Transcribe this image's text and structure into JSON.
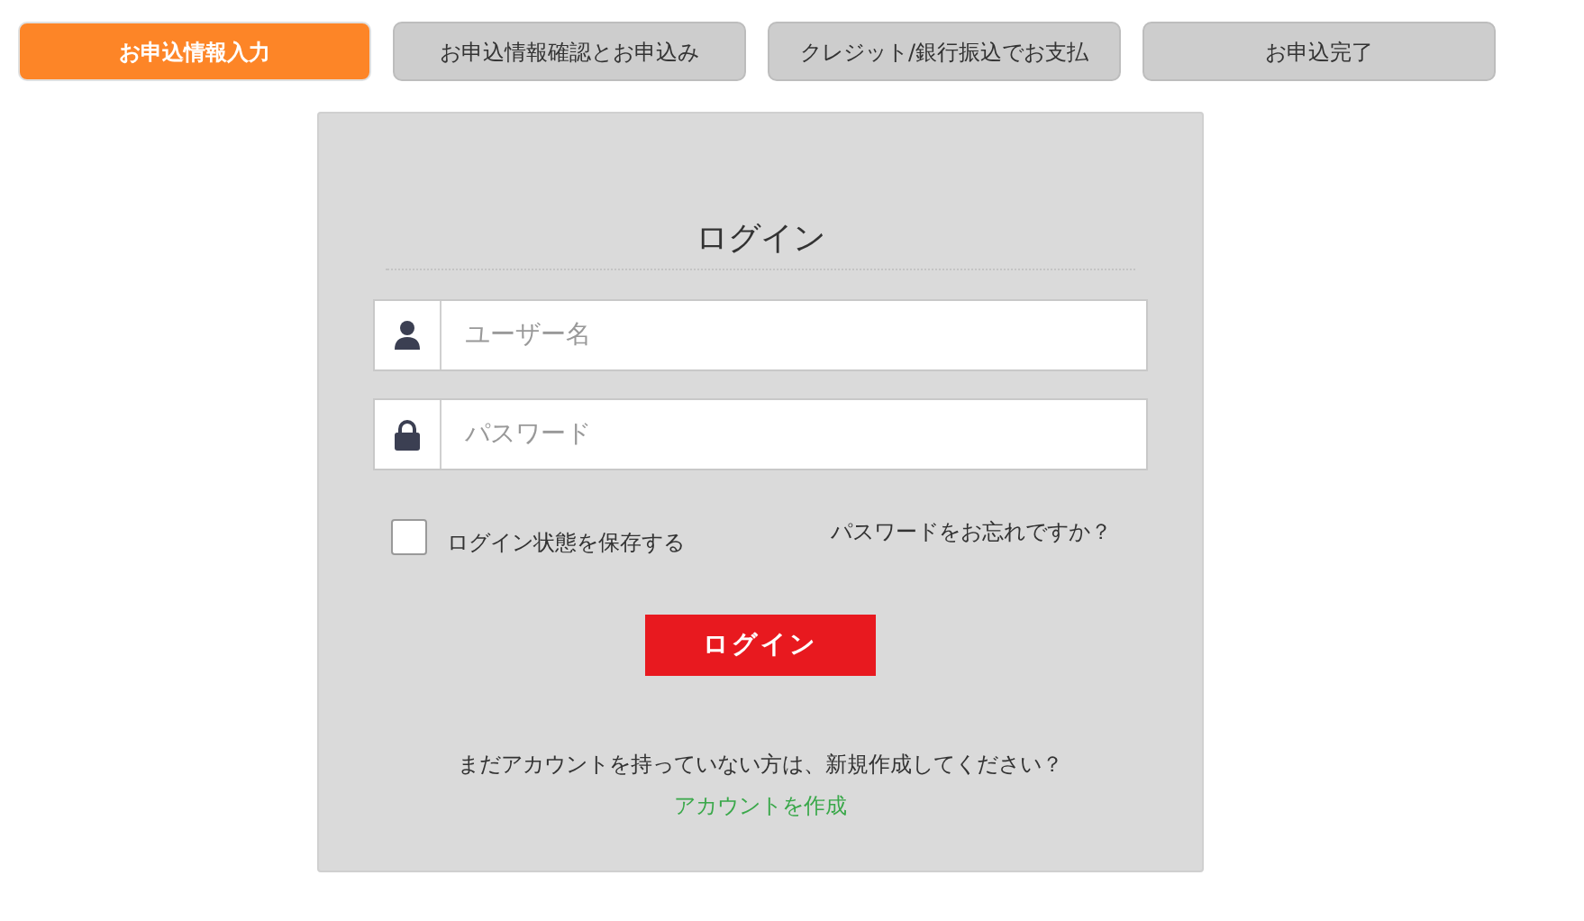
{
  "steps": [
    {
      "label": "お申込情報入力",
      "selected": true
    },
    {
      "label": "お申込情報確認とお申込み",
      "selected": false
    },
    {
      "label": "クレジット/銀行振込でお支払",
      "selected": false
    },
    {
      "label": "お申込完了",
      "selected": false
    }
  ],
  "login": {
    "title": "ログイン",
    "fields": [
      {
        "kind": "user",
        "placeholder": "ユーザー名"
      },
      {
        "kind": "password",
        "placeholder": "パスワード"
      }
    ],
    "remember": {
      "label": "ログイン状態を保存する",
      "checked": false
    },
    "forgot_link": "パスワードをお忘れですか？",
    "submit": "ログイン",
    "signup_prompt": "まだアカウントを持っていない方は、新規作成してください？",
    "signup_link": "アカウントを作成"
  }
}
